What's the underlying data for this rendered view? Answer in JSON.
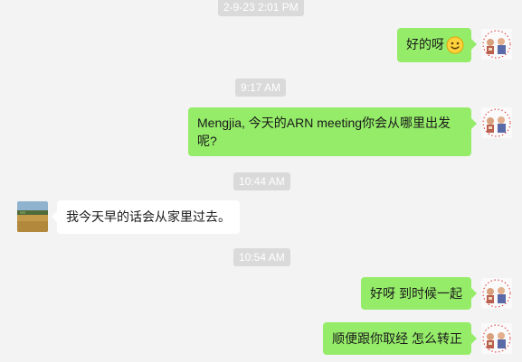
{
  "timestamps": [
    "2-9-23 2:01 PM",
    "9:17 AM",
    "10:44 AM",
    "10:54 AM"
  ],
  "messages": [
    {
      "text": "好的呀",
      "emoji": "smile-emoji"
    },
    {
      "line1": "Mengjia, 今天的ARN meeting你会从哪里出发",
      "line2": "呢?"
    },
    {
      "text": "我今天早的话会从家里过去。"
    },
    {
      "text": "好呀 到时候一起"
    },
    {
      "text": "顺便跟你取经 怎么转正"
    }
  ],
  "colors": {
    "background": "#f3f3f3",
    "sent_bubble": "#95ec69",
    "received_bubble": "#ffffff",
    "timestamp_bg": "#dadada",
    "timestamp_text": "#ffffff"
  }
}
